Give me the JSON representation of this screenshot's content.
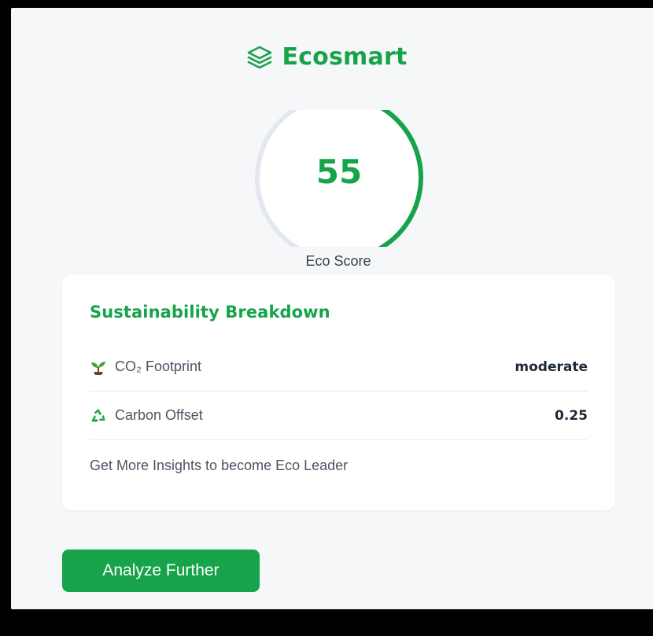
{
  "app": {
    "title": "Ecosmart",
    "icon": "layers-icon",
    "accent_color": "#17a34a"
  },
  "score": {
    "value": "55",
    "progress_fraction": 0.55,
    "label": "Eco Score",
    "ring_color": "#17a34a",
    "track_color": "#e3e8ef"
  },
  "breakdown": {
    "title": "Sustainability Breakdown",
    "rows": [
      {
        "icon": "seedling-icon",
        "label": "CO₂ Footprint",
        "value": "moderate"
      },
      {
        "icon": "recycle-icon",
        "label": "Carbon Offset",
        "value": "0.25"
      }
    ],
    "insight_text": "Get More Insights to become Eco Leader"
  },
  "actions": {
    "analyze_label": "Analyze Further"
  }
}
